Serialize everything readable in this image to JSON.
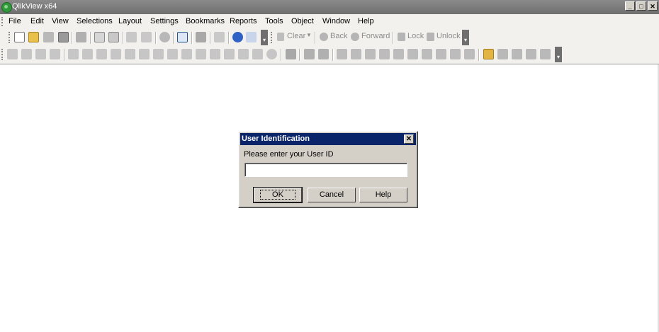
{
  "window": {
    "title": "QlikView x64",
    "minimize": "_",
    "maximize": "□",
    "close": "✕"
  },
  "menu": [
    "File",
    "Edit",
    "View",
    "Selections",
    "Layout",
    "Settings",
    "Bookmarks",
    "Reports",
    "Tools",
    "Object",
    "Window",
    "Help"
  ],
  "toolbar": {
    "clear": "Clear",
    "back": "Back",
    "forward": "Forward",
    "lock": "Lock",
    "unlock": "Unlock"
  },
  "dialog": {
    "title": "User Identification",
    "prompt": "Please enter your User ID",
    "input_value": "",
    "ok": "OK",
    "cancel": "Cancel",
    "help": "Help"
  },
  "colors": {
    "titlebar": "#7a7a7a",
    "dialog_title": "#0a246a",
    "dialog_face": "#d4d0c8"
  }
}
